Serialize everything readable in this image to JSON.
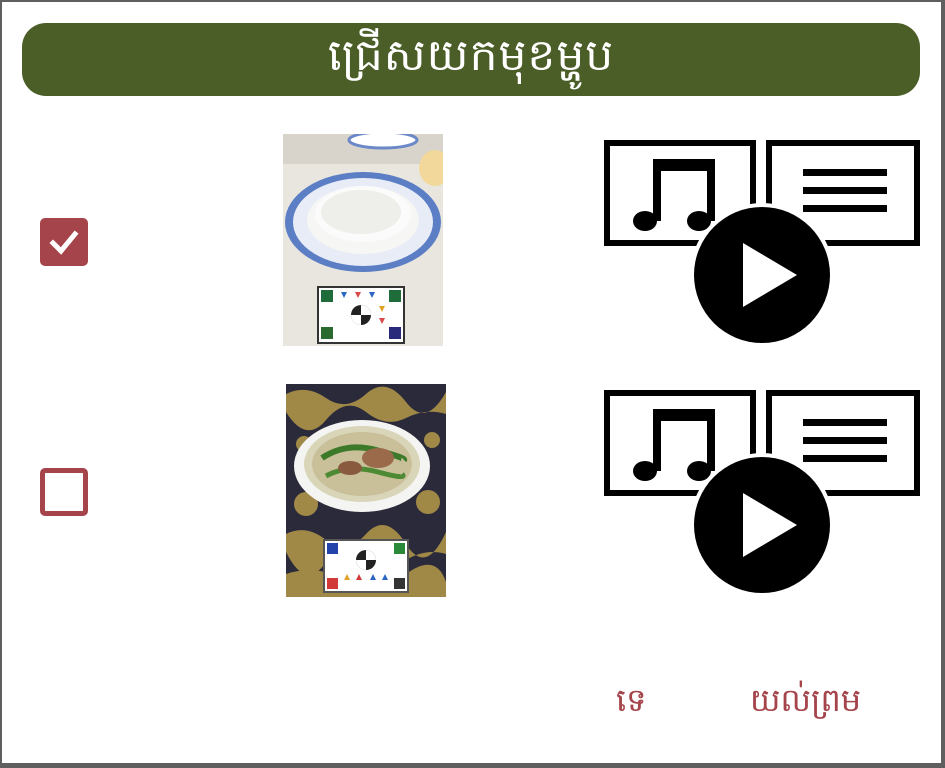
{
  "dialog": {
    "title": "ជ្រើសយកមុខម្ហូប",
    "title_bar_color": "#4b5e27",
    "accent_color": "#a5444a"
  },
  "items": [
    {
      "checked": true,
      "photo_subject": "plate of white rice with color calibration card",
      "media_icon": "play-audio-text-icon"
    },
    {
      "checked": false,
      "photo_subject": "bowl of noodle soup with vegetables and color calibration card",
      "media_icon": "play-audio-text-icon"
    }
  ],
  "footer": {
    "cancel_label": "ទេ",
    "ok_label": "យល់ព្រម"
  }
}
